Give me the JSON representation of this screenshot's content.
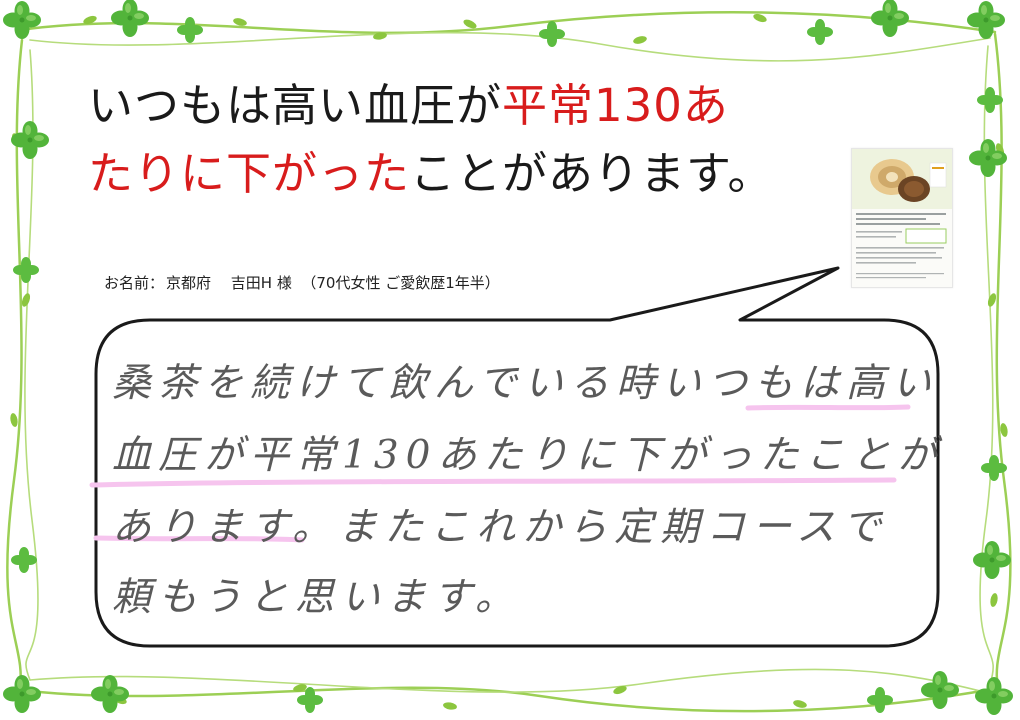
{
  "headline": {
    "line1_black": "いつもは高い血圧が",
    "line1_red": "平常130あ",
    "line2_red": "たりに下がった",
    "line2_black": "ことがあります。"
  },
  "customer": {
    "prefix": "お名前：",
    "name": "京都府　 吉田H 様",
    "details": "（70代女性 ご愛飲歴1年半）"
  },
  "testimonial": {
    "line1": "桑茶を続けて飲んでいる時いつもは高い",
    "line2": "血圧が平常130あたりに下がったことが",
    "line3": "あります。またこれから定期コースで",
    "line4": "頼もうと思います。"
  },
  "colors": {
    "vine": "#8cc63f",
    "leaf": "#52b43a",
    "leaf_light": "#8fd36a",
    "headline_red": "#d81c1c",
    "highlight_pink": "#f6c4ee",
    "bubble_border": "#1a1a1a"
  },
  "icons": [
    "four-leaf-clover-icon",
    "speech-bubble",
    "flyer-thumbnail"
  ]
}
